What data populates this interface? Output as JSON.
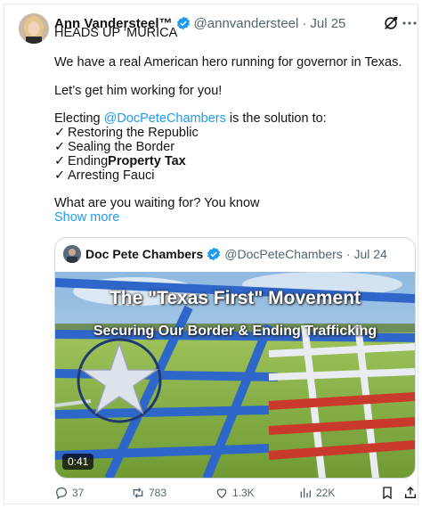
{
  "author": {
    "name": "Ann Vandersteel™",
    "handle": "@annvandersteel",
    "separator": "·",
    "date": "Jul 25",
    "avatar_icon": "profile-photo"
  },
  "body": {
    "line1": "HEADS UP ‘MURICA",
    "line2": "We have a real American hero running for governor in Texas.",
    "line3": "Let’s get him working for you!",
    "electing_prefix": "Electing ",
    "electing_mention": "@DocPeteChambers",
    "electing_suffix": " is the solution to:",
    "check_glyph": "✓",
    "items": [
      {
        "text": "Restoring the Republic"
      },
      {
        "text": "Sealing the Border"
      },
      {
        "text_prefix": "Ending ",
        "text_bold": "Property Tax"
      },
      {
        "text": "Arresting Fauci"
      }
    ],
    "closing": "What are you waiting for? You know",
    "show_more": "Show more"
  },
  "quote": {
    "name": "Doc Pete Chambers",
    "handle": "@DocPeteChambers",
    "separator": "·",
    "date": "Jul 24",
    "video": {
      "title": "The \"Texas First\" Movement",
      "subtitle": "Securing Our Border & Ending Trafficking",
      "duration": "0:41"
    }
  },
  "actions": {
    "replies": "37",
    "reposts": "783",
    "likes": "1.3K",
    "views": "22K"
  },
  "colors": {
    "accent": "#1d9bf0",
    "muted": "#536471",
    "verified": "#1d9bf0"
  }
}
